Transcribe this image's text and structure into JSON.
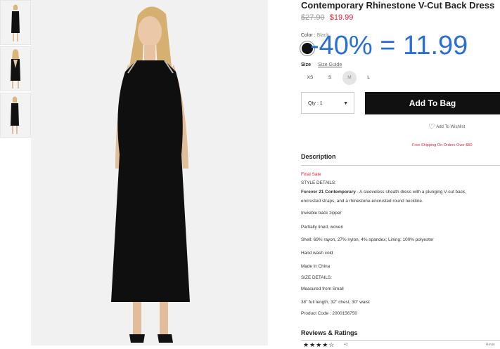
{
  "product": {
    "title": "Contemporary Rhinestone V-Cut Back Dress",
    "old_price": "$27.90",
    "new_price": "$19.99"
  },
  "color": {
    "label": "Color",
    "value": "Black",
    "swatch": "#111111"
  },
  "overlay_annotation": "-40% = 11.99",
  "size": {
    "label": "Size",
    "guide_label": "Size Guide",
    "options": [
      "XS",
      "S",
      "M",
      "L"
    ],
    "selected": "M"
  },
  "qty": {
    "label": "Qty : 1"
  },
  "add_to_bag_label": "Add To Bag",
  "wishlist_label": "Add To Wishlist",
  "promo_text": "Free Shipping On Orders Over $50",
  "description": {
    "heading": "Description",
    "final_sale": "Final Sale",
    "style_details_label": "STYLE DETAILS:",
    "brand": "Forever 21 Contemporary",
    "summary": " - A sleeveless sheath dress with a plunging V-cut back,",
    "summary_cont": "encrusted straps, and a rhinestone-encrusted round neckline.",
    "lines": [
      "Invisible back zipper",
      "Partially lined, woven",
      "Shell: 69% rayon, 27% nylon, 4% spandex; Lining: 100% polyester",
      "Hand wash cold",
      "Made in China"
    ],
    "size_details_label": "SIZE DETAILS:",
    "measured": "Measured from Small",
    "measurements": "38\" full length, 32\" chest, 30\" waist",
    "product_code": "Product Code : 2000156750"
  },
  "reviews": {
    "heading": "Reviews & Ratings",
    "stars": "★★★★☆",
    "count": "43",
    "right_label": "Revie"
  },
  "colors": {
    "accent_red": "#e0243c",
    "overlay_blue": "#2a6fd6",
    "button_black": "#111111"
  }
}
